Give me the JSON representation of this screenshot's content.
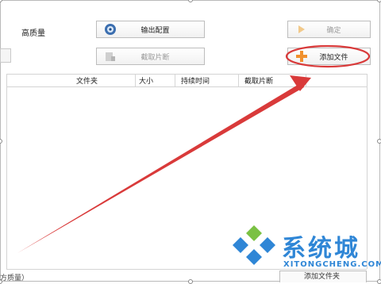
{
  "settings": {
    "quality_label": "高质量",
    "output_config_label": "输出配置",
    "trim_label": "截取片断",
    "confirm_label": "确定",
    "add_file_label": "添加文件"
  },
  "table": {
    "columns": [
      "文件夹",
      "大小",
      "持续时间",
      "截取片断"
    ]
  },
  "footer": {
    "left_text": "方质量）",
    "add_folder_label": "添加文件夹"
  },
  "watermark": {
    "name": "系统城",
    "domain": "XITONGCHENG.COM"
  },
  "colors": {
    "annotation_red": "#d93a3a",
    "watermark_blue": "#2f86d6",
    "watermark_green": "#7ac143"
  }
}
